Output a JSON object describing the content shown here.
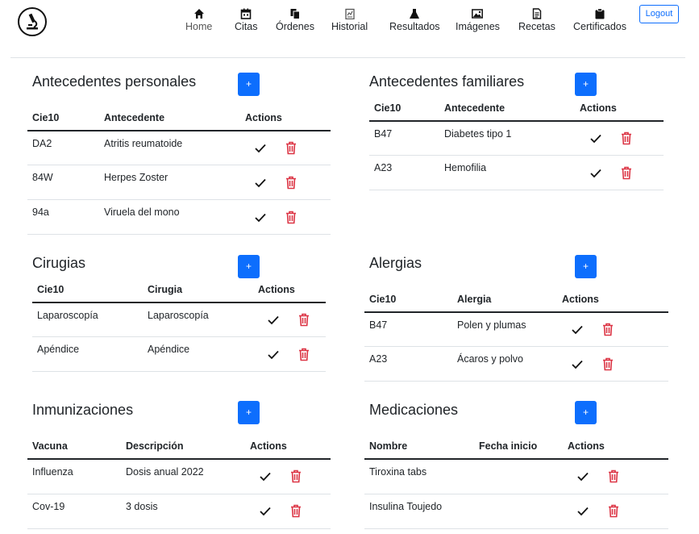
{
  "nav": {
    "items": [
      {
        "label": "Home",
        "icon": "home-icon"
      },
      {
        "label": "Citas",
        "icon": "calendar-icon"
      },
      {
        "label": "Órdenes",
        "icon": "files-icon"
      },
      {
        "label": "Historial",
        "icon": "history-icon"
      },
      {
        "label": "Resultados",
        "icon": "flask-icon"
      },
      {
        "label": "Imágenes",
        "icon": "image-icon"
      },
      {
        "label": "Recetas",
        "icon": "prescription-icon"
      },
      {
        "label": "Certificados",
        "icon": "clipboard-icon"
      }
    ],
    "logout": "Logout"
  },
  "colors": {
    "primary": "#0d6efd",
    "danger": "#dc3545",
    "text": "#212529"
  },
  "add_label": "+",
  "sections": {
    "personales": {
      "title": "Antecedentes personales",
      "headers": [
        "Cie10",
        "Antecedente",
        "Actions"
      ],
      "rows": [
        [
          "DA2",
          "Atritis reumatoide"
        ],
        [
          "84W",
          "Herpes Zoster"
        ],
        [
          "94a",
          "Viruela del mono"
        ]
      ]
    },
    "familiares": {
      "title": "Antecedentes familiares",
      "headers": [
        "Cie10",
        "Antecedente",
        "Actions"
      ],
      "rows": [
        [
          "B47",
          "Diabetes tipo 1"
        ],
        [
          "A23",
          "Hemofilia"
        ]
      ]
    },
    "cirugias": {
      "title": "Cirugias",
      "headers": [
        "Cie10",
        "Cirugia",
        "Actions"
      ],
      "rows": [
        [
          "Laparoscopía",
          "Laparoscopía"
        ],
        [
          "Apéndice",
          "Apéndice"
        ]
      ]
    },
    "alergias": {
      "title": "Alergias",
      "headers": [
        "Cie10",
        "Alergia",
        "Actions"
      ],
      "rows": [
        [
          "B47",
          "Polen y plumas"
        ],
        [
          "A23",
          "Ácaros y polvo"
        ]
      ]
    },
    "inmunizaciones": {
      "title": "Inmunizaciones",
      "headers": [
        "Vacuna",
        "Descripción",
        "Actions"
      ],
      "rows": [
        [
          "Influenza",
          "Dosis anual 2022"
        ],
        [
          "Cov-19",
          "3 dosis"
        ]
      ]
    },
    "medicaciones": {
      "title": "Medicaciones",
      "headers": [
        "Nombre",
        "Fecha inicio",
        "Actions"
      ],
      "rows": [
        [
          "Tiroxina tabs",
          ""
        ],
        [
          "Insulina Toujedo",
          ""
        ]
      ]
    }
  }
}
